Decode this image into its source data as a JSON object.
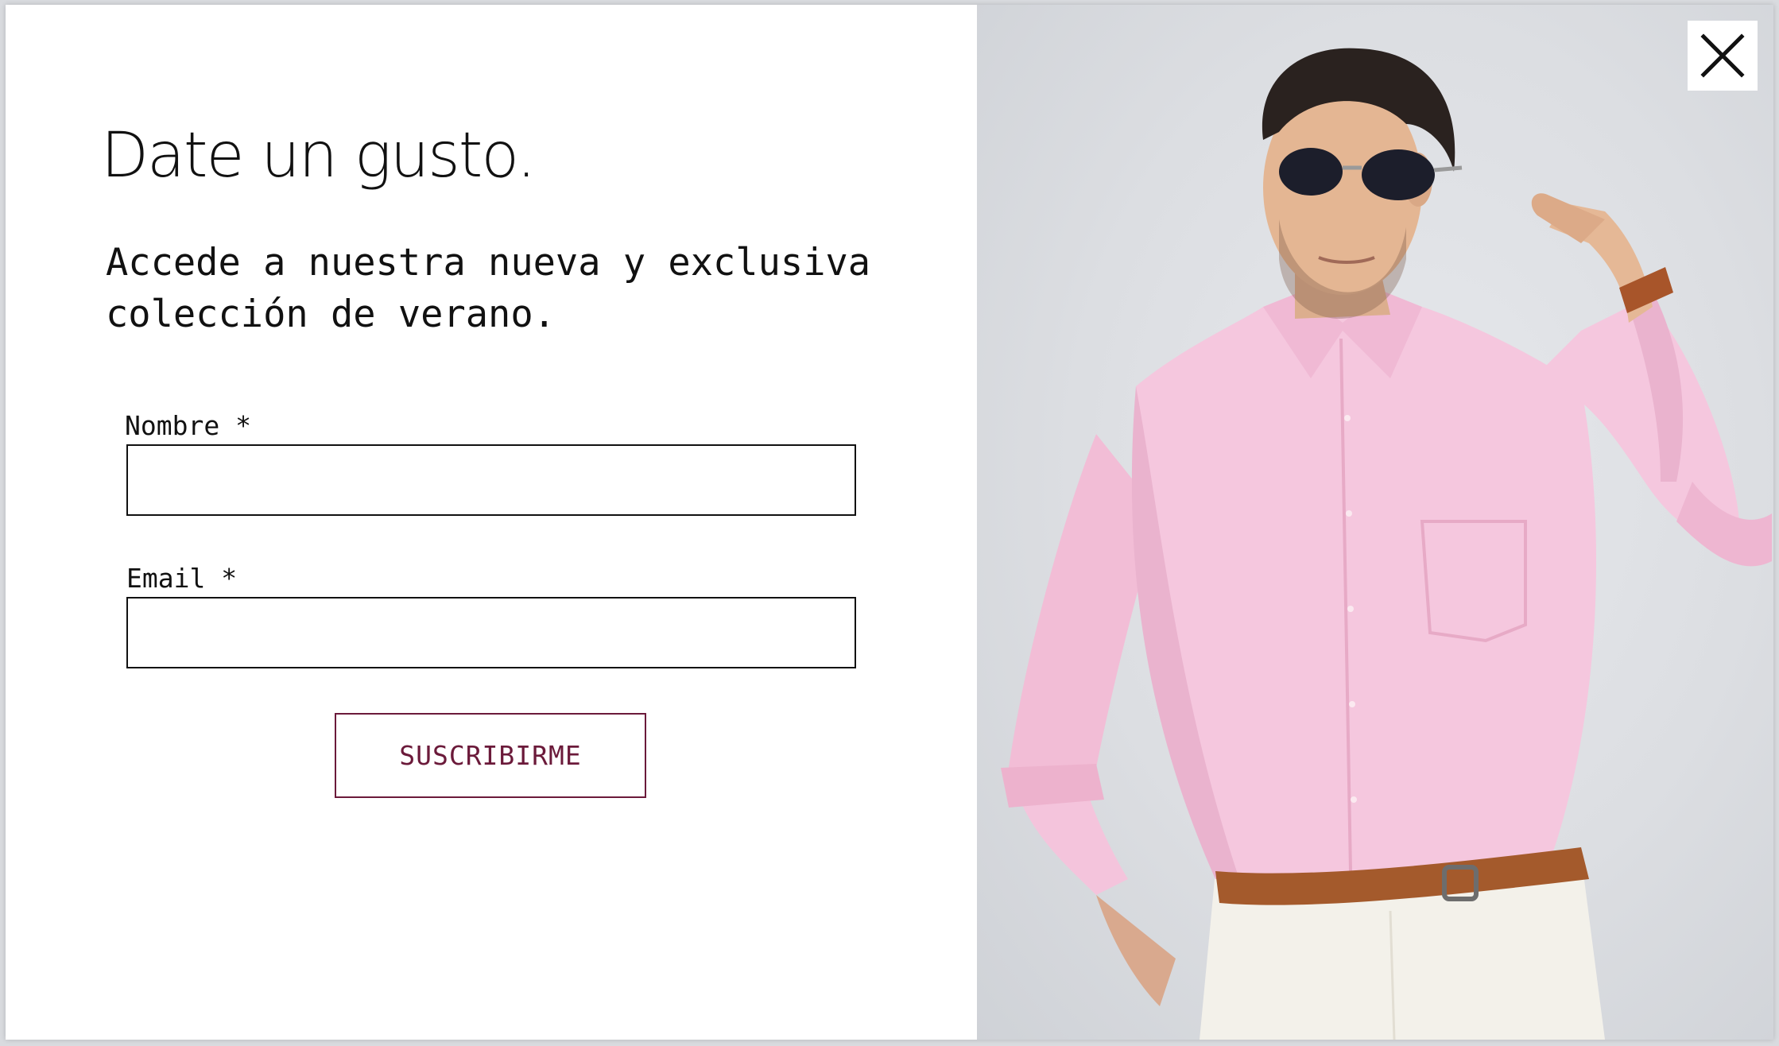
{
  "popup": {
    "headline": "Date un gusto.",
    "subtitle": "Accede a nuestra nueva y exclusiva colección de verano.",
    "form": {
      "name_label": "Nombre *",
      "name_value": "",
      "email_label": "Email *",
      "email_value": "",
      "submit_label": "SUSCRIBIRME"
    },
    "close_icon": "close-icon",
    "photo": "model-pink-shirt-sunglasses"
  },
  "colors": {
    "accent": "#6b1a3a",
    "text": "#111111",
    "background": "#ffffff",
    "photo_background": "#dcdee2"
  }
}
